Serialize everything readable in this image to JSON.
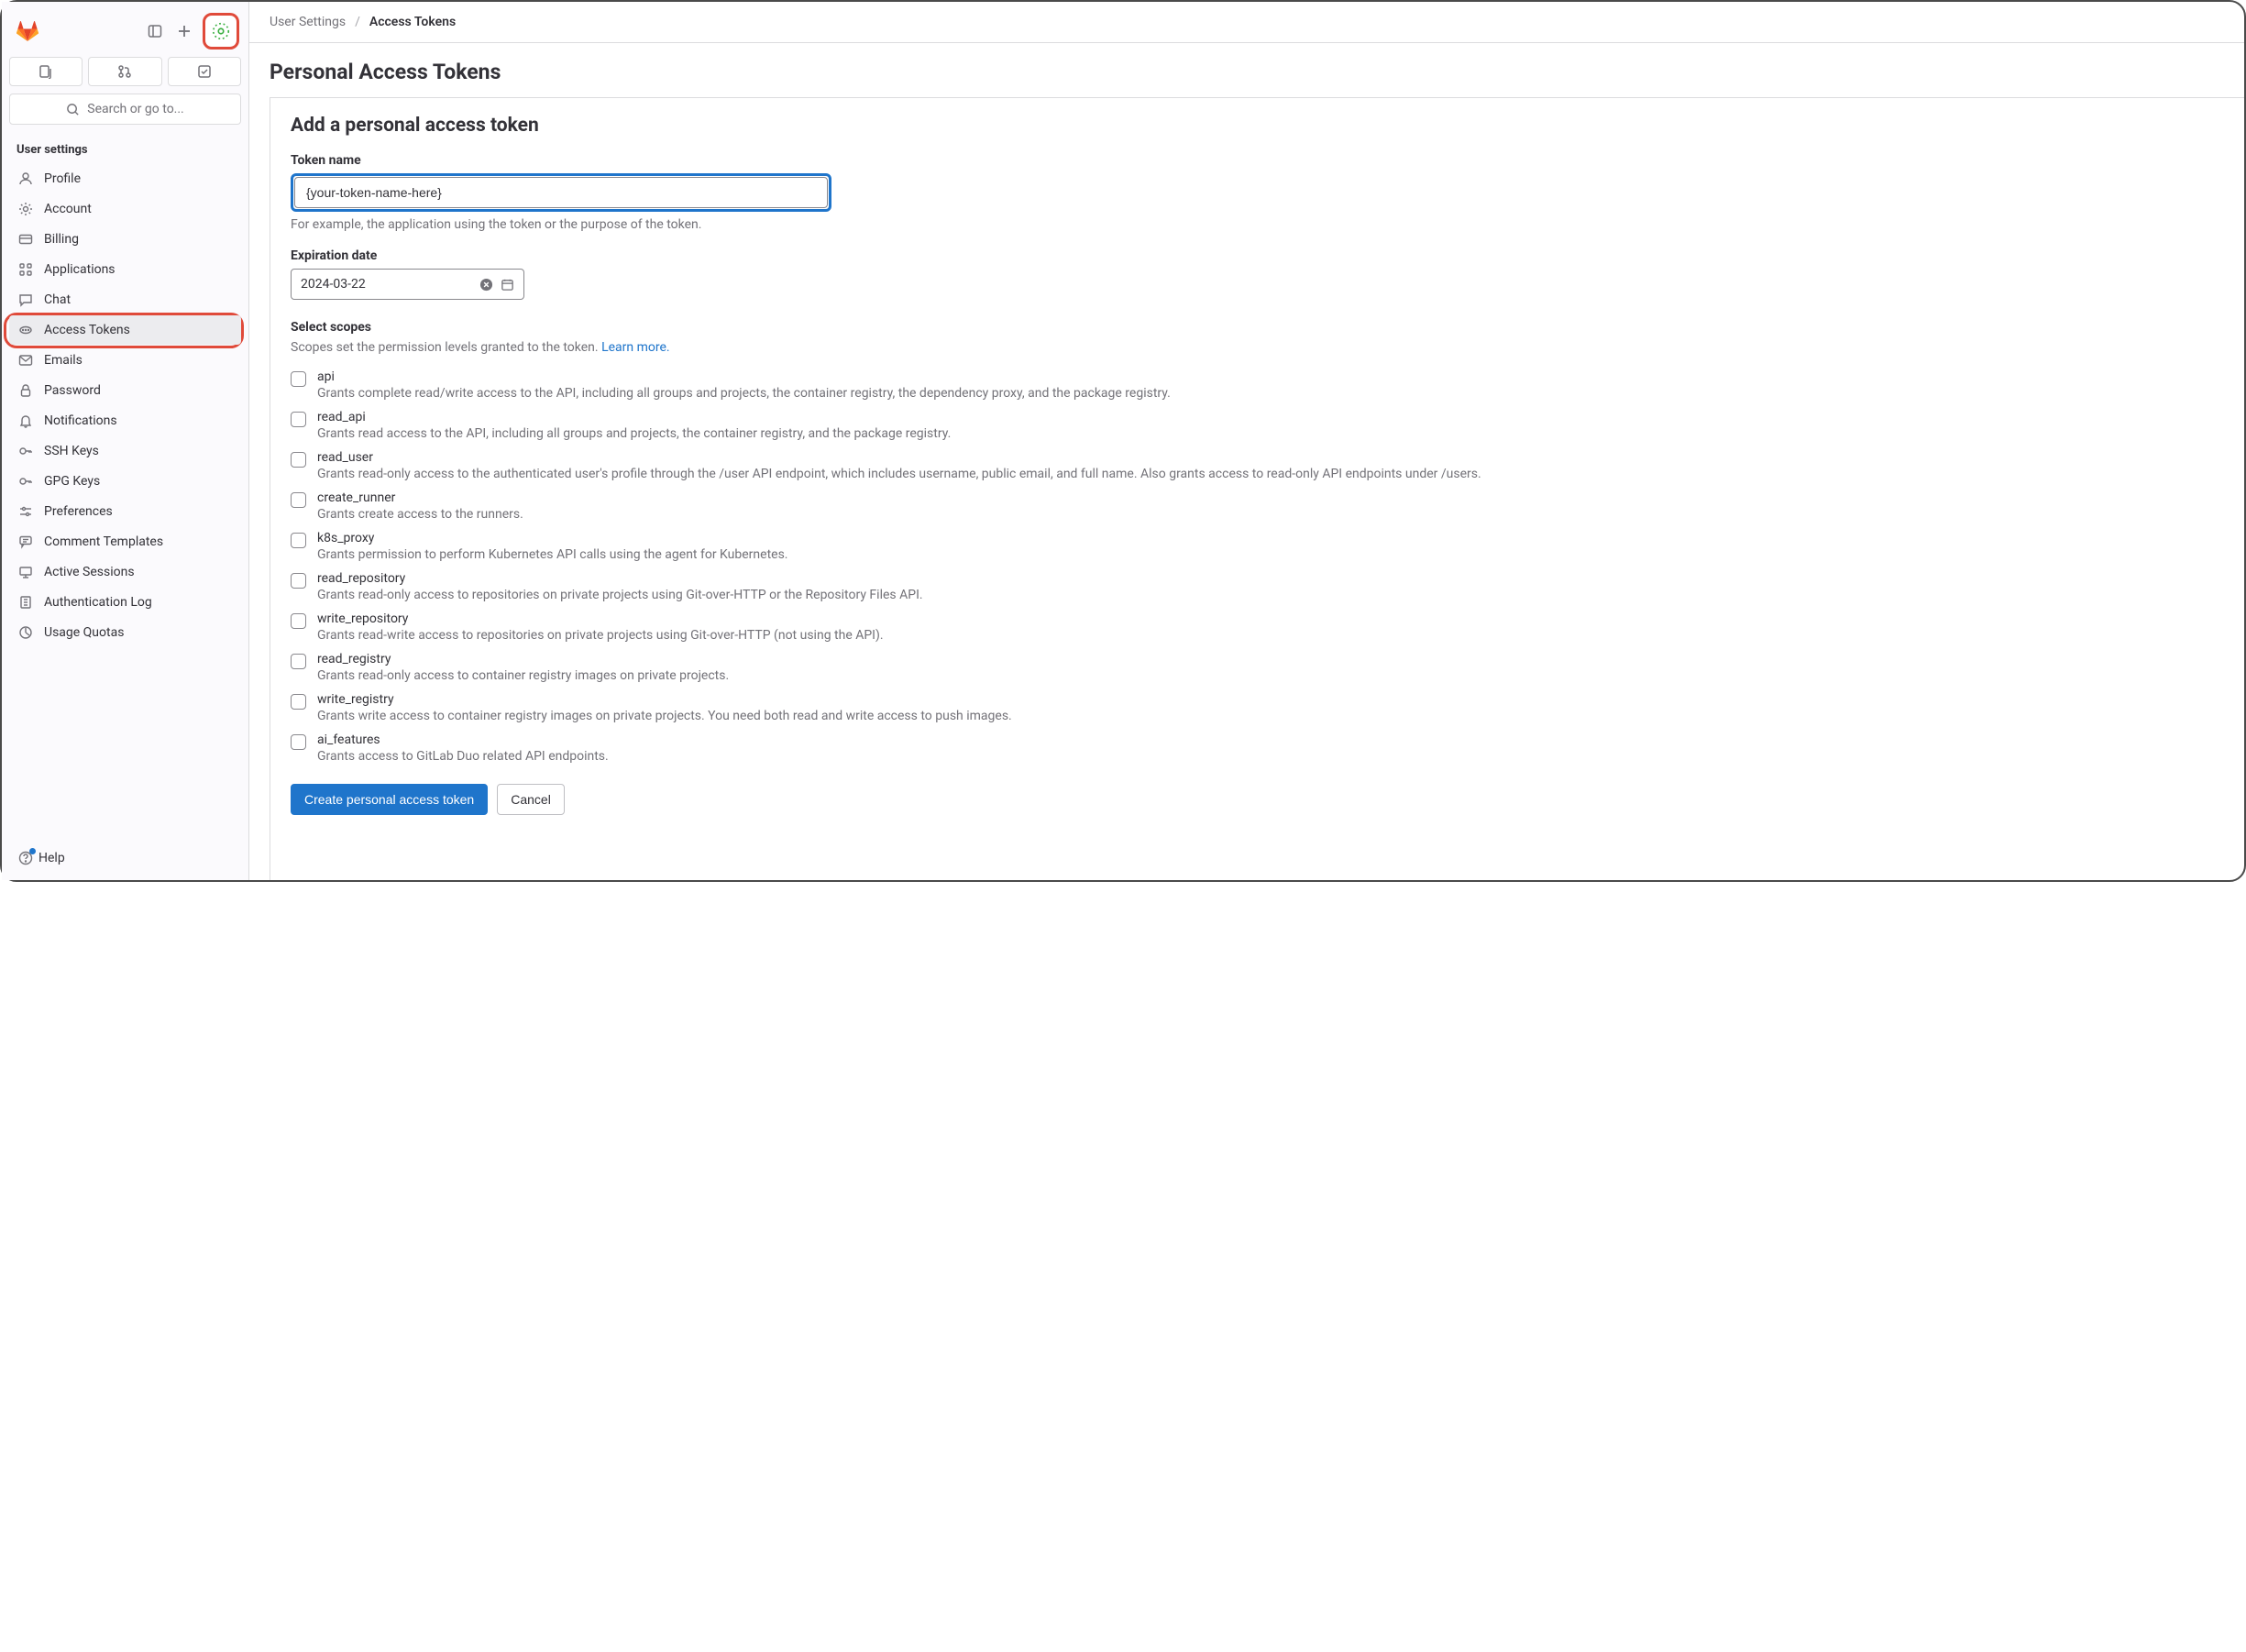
{
  "sidebar": {
    "search_placeholder": "Search or go to...",
    "section_heading": "User settings",
    "items": [
      {
        "icon": "profile",
        "label": "Profile"
      },
      {
        "icon": "account",
        "label": "Account"
      },
      {
        "icon": "billing",
        "label": "Billing"
      },
      {
        "icon": "apps",
        "label": "Applications"
      },
      {
        "icon": "chat",
        "label": "Chat"
      },
      {
        "icon": "token",
        "label": "Access Tokens",
        "active": true
      },
      {
        "icon": "emails",
        "label": "Emails"
      },
      {
        "icon": "password",
        "label": "Password"
      },
      {
        "icon": "notifications",
        "label": "Notifications"
      },
      {
        "icon": "sshkeys",
        "label": "SSH Keys"
      },
      {
        "icon": "gpgkeys",
        "label": "GPG Keys"
      },
      {
        "icon": "preferences",
        "label": "Preferences"
      },
      {
        "icon": "comment",
        "label": "Comment Templates"
      },
      {
        "icon": "sessions",
        "label": "Active Sessions"
      },
      {
        "icon": "authlog",
        "label": "Authentication Log"
      },
      {
        "icon": "quotas",
        "label": "Usage Quotas"
      }
    ],
    "help_label": "Help"
  },
  "breadcrumb": {
    "parent": "User Settings",
    "current": "Access Tokens"
  },
  "page_title": "Personal Access Tokens",
  "form": {
    "heading": "Add a personal access token",
    "token_name_label": "Token name",
    "token_name_value": "{your-token-name-here}",
    "token_name_help": "For example, the application using the token or the purpose of the token.",
    "expiration_label": "Expiration date",
    "expiration_value": "2024-03-22",
    "scopes_label": "Select scopes",
    "scopes_desc": "Scopes set the permission levels granted to the token. ",
    "scopes_learn_more": "Learn more.",
    "scopes": [
      {
        "name": "api",
        "desc": "Grants complete read/write access to the API, including all groups and projects, the container registry, the dependency proxy, and the package registry."
      },
      {
        "name": "read_api",
        "desc": "Grants read access to the API, including all groups and projects, the container registry, and the package registry."
      },
      {
        "name": "read_user",
        "desc": "Grants read-only access to the authenticated user's profile through the /user API endpoint, which includes username, public email, and full name. Also grants access to read-only API endpoints under /users."
      },
      {
        "name": "create_runner",
        "desc": "Grants create access to the runners."
      },
      {
        "name": "k8s_proxy",
        "desc": "Grants permission to perform Kubernetes API calls using the agent for Kubernetes."
      },
      {
        "name": "read_repository",
        "desc": "Grants read-only access to repositories on private projects using Git-over-HTTP or the Repository Files API."
      },
      {
        "name": "write_repository",
        "desc": "Grants read-write access to repositories on private projects using Git-over-HTTP (not using the API)."
      },
      {
        "name": "read_registry",
        "desc": "Grants read-only access to container registry images on private projects."
      },
      {
        "name": "write_registry",
        "desc": "Grants write access to container registry images on private projects. You need both read and write access to push images."
      },
      {
        "name": "ai_features",
        "desc": "Grants access to GitLab Duo related API endpoints."
      }
    ],
    "submit_label": "Create personal access token",
    "cancel_label": "Cancel"
  }
}
